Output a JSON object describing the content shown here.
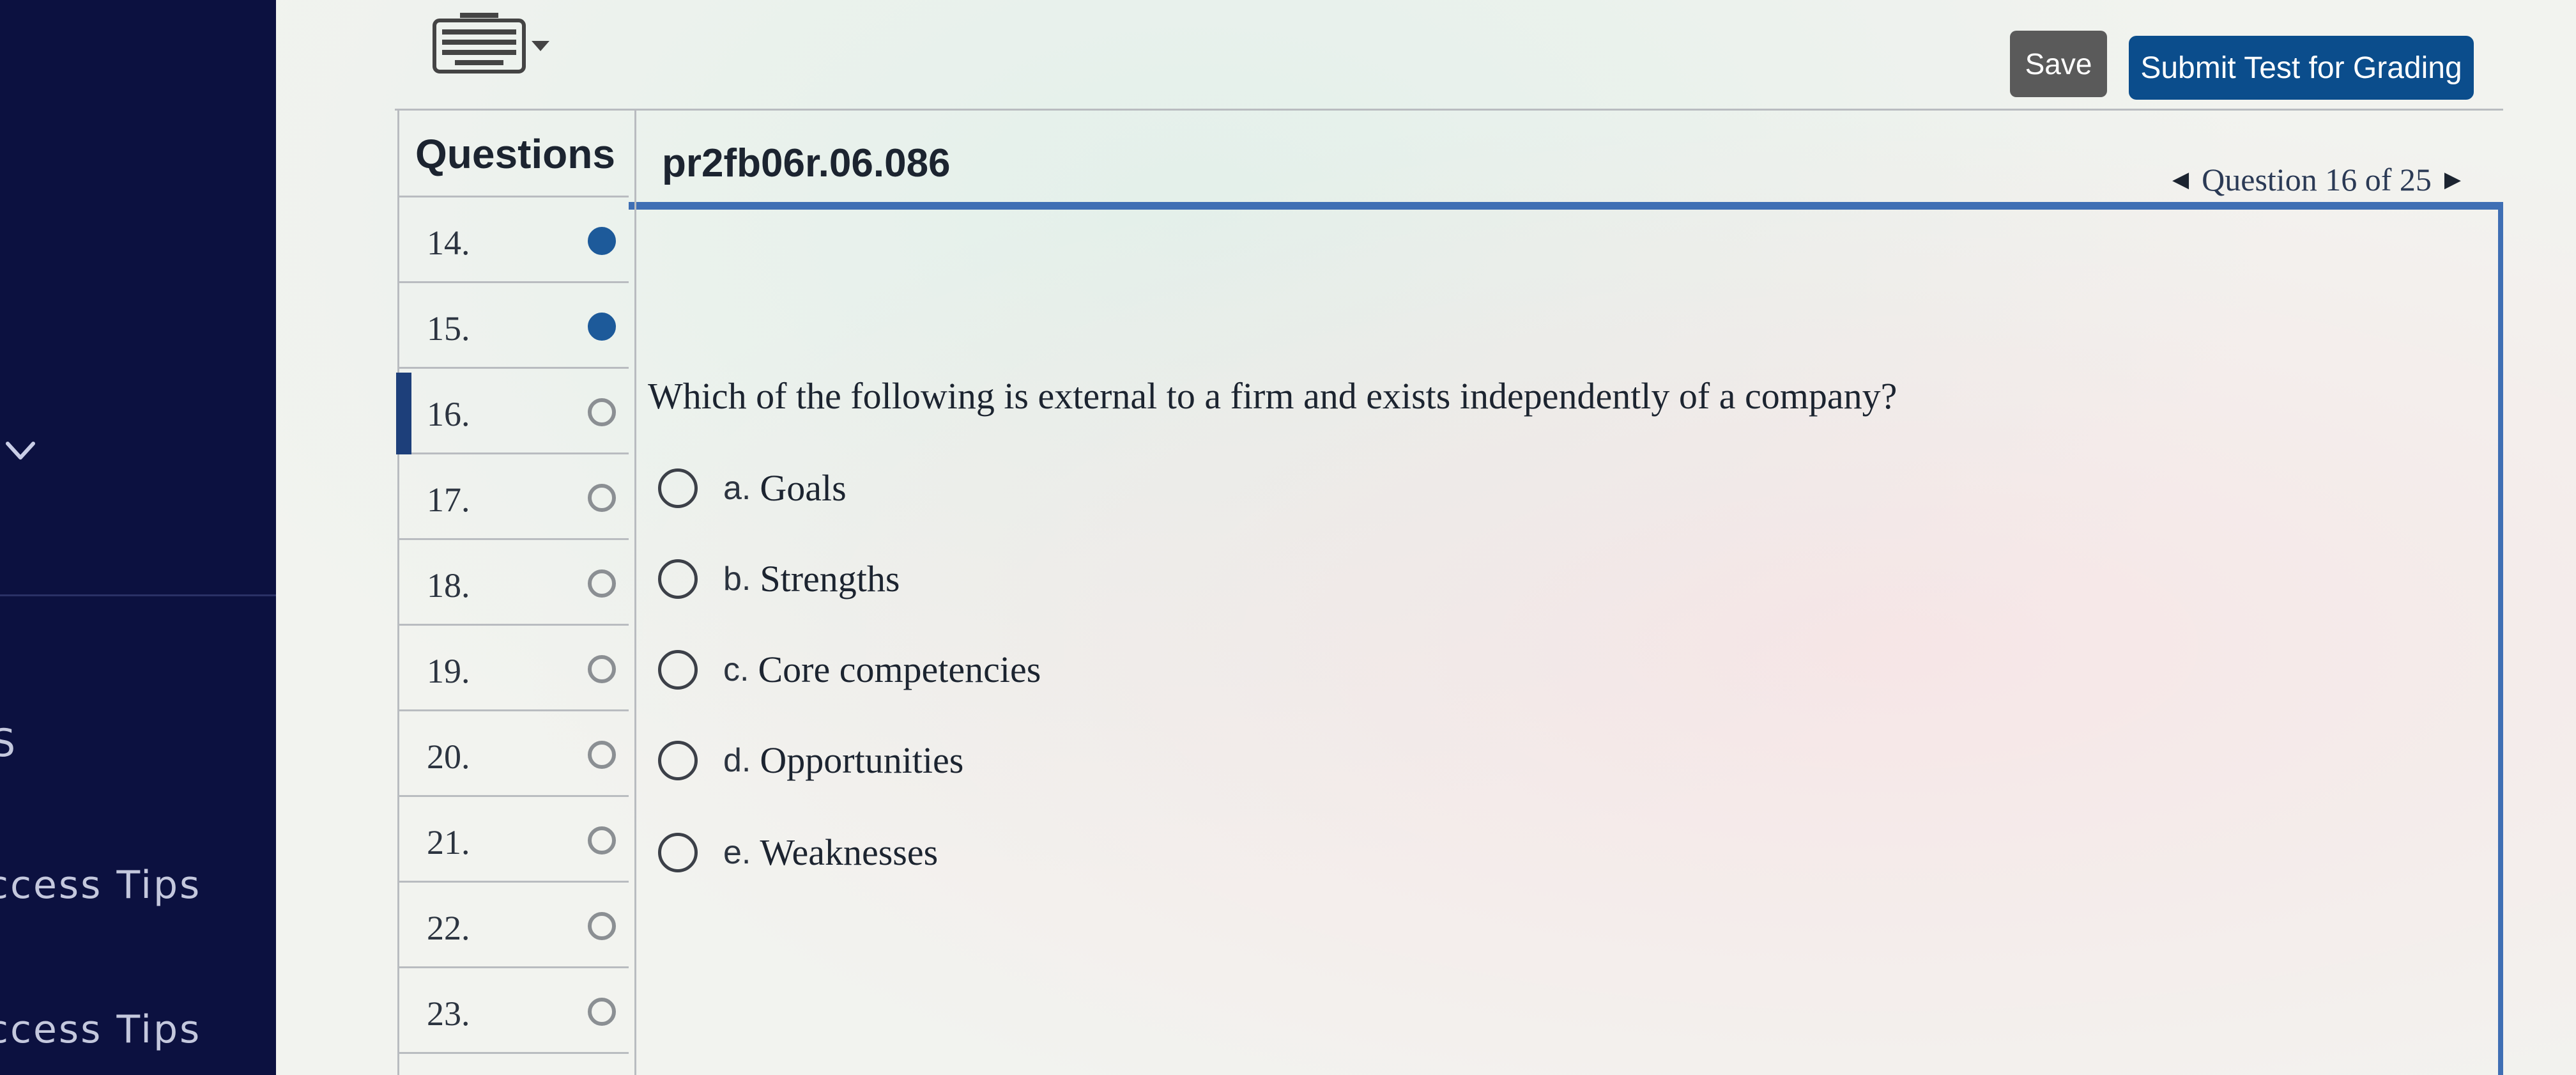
{
  "sidebar": {
    "partial_s": "S",
    "tips_label_1": "ccess Tips",
    "tips_label_2": "ccess Tips"
  },
  "toolbar": {
    "keyboard_icon": "keyboard-icon",
    "save_label": "Save",
    "submit_label": "Submit Test for Grading"
  },
  "questions_panel": {
    "heading": "Questions",
    "items": [
      {
        "number": "14.",
        "status": "answered"
      },
      {
        "number": "15.",
        "status": "answered"
      },
      {
        "number": "16.",
        "status": "unanswered",
        "current": true
      },
      {
        "number": "17.",
        "status": "unanswered"
      },
      {
        "number": "18.",
        "status": "unanswered"
      },
      {
        "number": "19.",
        "status": "unanswered"
      },
      {
        "number": "20.",
        "status": "unanswered"
      },
      {
        "number": "21.",
        "status": "unanswered"
      },
      {
        "number": "22.",
        "status": "unanswered"
      },
      {
        "number": "23.",
        "status": "unanswered"
      }
    ]
  },
  "question": {
    "id": "pr2fb06r.06.086",
    "nav_label": "Question 16 of 25",
    "text": "Which of the following is external to a firm and exists independently of a company?",
    "options": [
      {
        "letter": "a.",
        "text": "Goals"
      },
      {
        "letter": "b.",
        "text": "Strengths"
      },
      {
        "letter": "c.",
        "text": "Core competencies"
      },
      {
        "letter": "d.",
        "text": "Opportunities"
      },
      {
        "letter": "e.",
        "text": "Weaknesses"
      }
    ]
  },
  "colors": {
    "sidebar_bg": "#0c1140",
    "accent_blue": "#0b4d8c",
    "panel_border": "#3f6fb4",
    "save_bg": "#5a5a5a"
  }
}
